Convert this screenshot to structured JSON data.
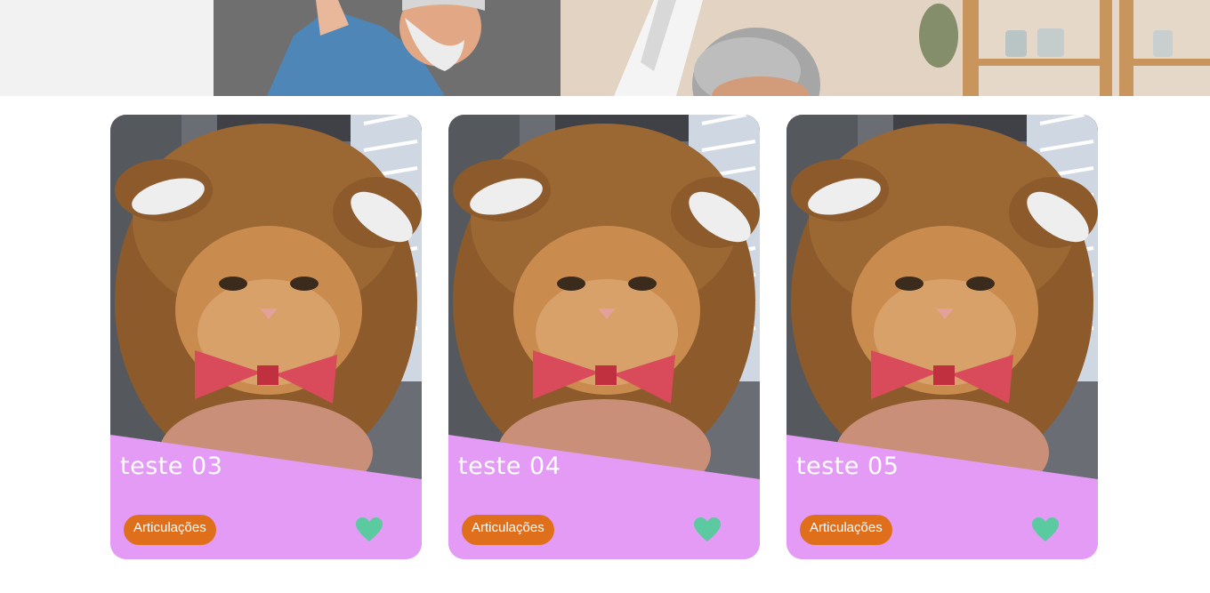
{
  "hero": {
    "image_icon": "elderly-couple-stretching-photo"
  },
  "cards": [
    {
      "title": "teste 03",
      "tag": "Articulações",
      "image_icon": "cat-in-bear-costume-photo",
      "favorite_icon": "heart-icon"
    },
    {
      "title": "teste 04",
      "tag": "Articulações",
      "image_icon": "cat-in-bear-costume-photo",
      "favorite_icon": "heart-icon"
    },
    {
      "title": "teste 05",
      "tag": "Articulações",
      "image_icon": "cat-in-bear-costume-photo",
      "favorite_icon": "heart-icon"
    }
  ],
  "colors": {
    "card_background": "#e39bf5",
    "tag_background": "#e06f1b",
    "heart": "#5ccaa0",
    "title_text": "#ffffff"
  }
}
